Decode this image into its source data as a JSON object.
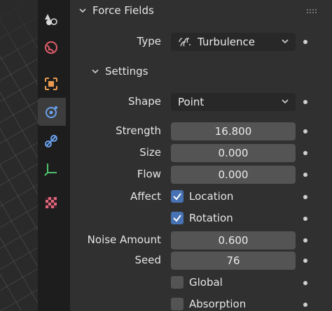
{
  "panel": {
    "title": "Force Fields",
    "type_label": "Type",
    "type_value": "Turbulence",
    "settings": {
      "title": "Settings",
      "shape_label": "Shape",
      "shape_value": "Point",
      "strength_label": "Strength",
      "strength_value": "16.800",
      "size_label": "Size",
      "size_value": "0.000",
      "flow_label": "Flow",
      "flow_value": "0.000",
      "affect_label": "Affect",
      "location_label": "Location",
      "rotation_label": "Rotation",
      "noise_amount_label": "Noise Amount",
      "noise_amount_value": "0.600",
      "seed_label": "Seed",
      "seed_value": "76",
      "global_label": "Global",
      "absorption_label": "Absorption"
    }
  },
  "checkboxes": {
    "location": true,
    "rotation": true,
    "global": false,
    "absorption": false
  },
  "tabs": [
    "scene-icon",
    "world-icon",
    "object-icon",
    "physics-icon",
    "constraints-icon",
    "object-data-icon",
    "texture-icon"
  ],
  "colors": {
    "accent": "#4772b3",
    "panel_bg": "#303030",
    "field_bg": "#545454",
    "dropdown_bg": "#282828",
    "active_tab": "#3d3d3d"
  }
}
